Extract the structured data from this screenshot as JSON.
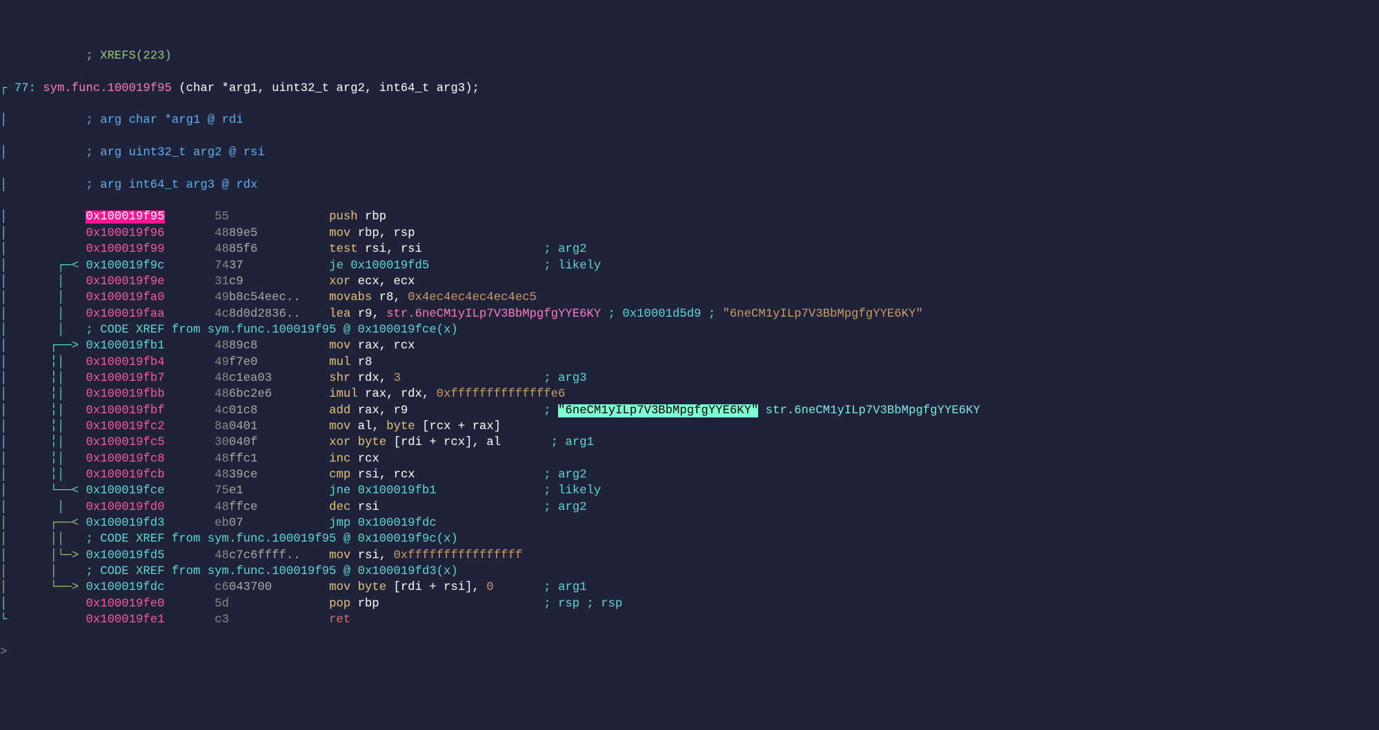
{
  "xrefs_line": "; XREFS(223)",
  "func_line": {
    "num": "┌ 77: ",
    "name": "sym.func.100019f95",
    "sig": " (char *arg1, uint32_t arg2, int64_t arg3);"
  },
  "args": [
    "; arg char *arg1 @ rdi",
    "; arg uint32_t arg2 @ rsi",
    "; arg int64_t arg3 @ rdx"
  ],
  "rows": [
    {
      "g": "│           ",
      "a": "0x100019f95",
      "aC": "hl-pink",
      "b1": "55",
      "b2": "",
      "mn": "push",
      "op": " rbp",
      "opC": "white",
      "c": ""
    },
    {
      "g": "│           ",
      "a": "0x100019f96",
      "aC": "magenta",
      "b1": "48",
      "b2": "89e5",
      "mn": "mov",
      "op": " rbp, rsp",
      "opC": "white",
      "c": ""
    },
    {
      "g": "│           ",
      "a": "0x100019f99",
      "aC": "magenta",
      "b1": "48",
      "b2": "85f6",
      "mn": "test",
      "op": " rsi, rsi",
      "opC": "white",
      "c": "; arg2",
      "cC": "teal"
    },
    {
      "g": "│       ┌─< ",
      "a": "0x100019f9c",
      "aC": "teal",
      "b1": "74",
      "b2": "37",
      "mn": "je",
      "mnC": "teal",
      "op": " 0x100019fd5",
      "opC": "teal",
      "c": "; likely",
      "cC": "teal"
    },
    {
      "g": "│       │   ",
      "a": "0x100019f9e",
      "aC": "magenta",
      "b1": "31",
      "b2": "c9",
      "mn": "xor",
      "op": " ecx, ecx",
      "opC": "white",
      "c": ""
    },
    {
      "g": "│       │   ",
      "a": "0x100019fa0",
      "aC": "magenta",
      "b1": "49",
      "b2": "b8c54eec..",
      "mn": "movabs",
      "op": " r8, ",
      "op2": "0x4ec4ec4ec4ec4ec5",
      "op2C": "orange",
      "opC": "white",
      "c": ""
    },
    {
      "g": "│       │   ",
      "a": "0x100019faa",
      "aC": "magenta",
      "b1": "4c",
      "b2": "8d0d2836..",
      "mn": "lea",
      "op": " r9, ",
      "opC": "white",
      "sym": "str.6neCM1yILp7V3BbMpgfgYYE6KY",
      "symC": "pink",
      "c1": " ; ",
      "ad": "0x10001d5d9",
      "adC": "teal",
      "c2": " ; ",
      "str": "\"6neCM1yILp7V3BbMpgfgYYE6KY\"",
      "strC": "orange"
    },
    {
      "xref": "; CODE XREF from sym.func.100019f95 @ 0x100019fce(x)",
      "g": "│       │   "
    },
    {
      "g": "│      ┌──> ",
      "a": "0x100019fb1",
      "aC": "teal",
      "b1": "48",
      "b2": "89c8",
      "mn": "mov",
      "op": " rax, rcx",
      "opC": "white",
      "c": ""
    },
    {
      "g": "│      ╎│   ",
      "a": "0x100019fb4",
      "aC": "magenta",
      "b1": "49",
      "b2": "f7e0",
      "mn": "mul",
      "op": " r8",
      "opC": "white",
      "c": ""
    },
    {
      "g": "│      ╎│   ",
      "a": "0x100019fb7",
      "aC": "magenta",
      "b1": "48",
      "b2": "c1ea03",
      "mn": "shr",
      "op": " rdx, ",
      "op2": "3",
      "op2C": "orange",
      "opC": "white",
      "c": "; arg3",
      "cC": "teal"
    },
    {
      "g": "│      ╎│   ",
      "a": "0x100019fbb",
      "aC": "magenta",
      "b1": "48",
      "b2": "6bc2e6",
      "mn": "imul",
      "op": " rax, rdx, ",
      "op2": "0xffffffffffffffe6",
      "op2C": "orange",
      "opC": "white",
      "c": ""
    },
    {
      "g": "│      ╎│   ",
      "a": "0x100019fbf",
      "aC": "magenta",
      "b1": "4c",
      "b2": "01c8",
      "mn": "add",
      "op": " rax, r9",
      "opC": "white",
      "c": "; ",
      "hl": "\"6neCM1yILp7V3BbMpgfgYYE6KY\"",
      "hlC": "hl-cyan",
      "after": " str.6neCM1yILp7V3BbMpgfgYYE6KY",
      "afterC": "cyan"
    },
    {
      "g": "│      ╎│   ",
      "a": "0x100019fc2",
      "aC": "magenta",
      "b1": "8a",
      "b2": "0401",
      "mn": "mov",
      "op": " al, ",
      "kw": "byte",
      "kw2": " [rcx + rax]",
      "opC": "white",
      "c": ""
    },
    {
      "g": "│      ╎│   ",
      "a": "0x100019fc5",
      "aC": "magenta",
      "b1": "30",
      "b2": "040f",
      "mn": "xor",
      "op": " ",
      "kw": "byte",
      "kw2": " [rdi + rcx], al",
      "opC": "white",
      "c": " ; arg1",
      "cC": "teal"
    },
    {
      "g": "│      ╎│   ",
      "a": "0x100019fc8",
      "aC": "magenta",
      "b1": "48",
      "b2": "ffc1",
      "mn": "inc",
      "op": " rcx",
      "opC": "white",
      "c": ""
    },
    {
      "g": "│      ╎│   ",
      "a": "0x100019fcb",
      "aC": "magenta",
      "b1": "48",
      "b2": "39ce",
      "mn": "cmp",
      "op": " rsi, rcx",
      "opC": "white",
      "c": "; arg2",
      "cC": "teal"
    },
    {
      "g": "│      └──< ",
      "a": "0x100019fce",
      "aC": "teal",
      "b1": "75",
      "b2": "e1",
      "mn": "jne",
      "mnC": "teal",
      "op": " 0x100019fb1",
      "opC": "teal",
      "c": "; likely",
      "cC": "teal"
    },
    {
      "g": "│       │   ",
      "a": "0x100019fd0",
      "aC": "magenta",
      "b1": "48",
      "b2": "ffce",
      "mn": "dec",
      "op": " rsi",
      "opC": "white",
      "c": "; arg2",
      "cC": "teal"
    },
    {
      "g": "│      ┌──< ",
      "gC": "graph-g",
      "a": "0x100019fd3",
      "aC": "teal",
      "b1": "eb",
      "b2": "07",
      "mn": "jmp",
      "mnC": "teal",
      "op": " 0x100019fdc",
      "opC": "teal",
      "c": ""
    },
    {
      "xref": "; CODE XREF from sym.func.100019f95 @ 0x100019f9c(x)",
      "g": "│      ││   ",
      "gC": "graph-g"
    },
    {
      "g": "│      │└─> ",
      "gC": "graph-g",
      "a": "0x100019fd5",
      "aC": "teal",
      "b1": "48",
      "b2": "c7c6ffff..",
      "mn": "mov",
      "op": " rsi, ",
      "op2": "0xffffffffffffffff",
      "op2C": "orange",
      "opC": "white",
      "c": ""
    },
    {
      "xref": "; CODE XREF from sym.func.100019f95 @ 0x100019fd3(x)",
      "g": "│      │    ",
      "gC": "graph-g"
    },
    {
      "g": "│      └──> ",
      "gC": "graph-g",
      "a": "0x100019fdc",
      "aC": "teal",
      "b1": "c6",
      "b2": "043700",
      "mn": "mov",
      "op": " ",
      "kw": "byte",
      "kw2": " [rdi + rsi], ",
      "op2": "0",
      "op2C": "orange",
      "opC": "white",
      "c": "; arg1",
      "cC": "teal"
    },
    {
      "g": "│           ",
      "a": "0x100019fe0",
      "aC": "magenta",
      "b1": "5d",
      "b2": "",
      "mn": "pop",
      "op": " rbp",
      "opC": "white",
      "c": "; rsp ; rsp",
      "cC": "teal"
    },
    {
      "g": "└           ",
      "a": "0x100019fe1",
      "aC": "magenta",
      "b1": "c3",
      "b2": "",
      "mn": "ret",
      "mnC": "red",
      "op": "",
      "opC": "",
      "c": ""
    }
  ],
  "prompt": ">"
}
